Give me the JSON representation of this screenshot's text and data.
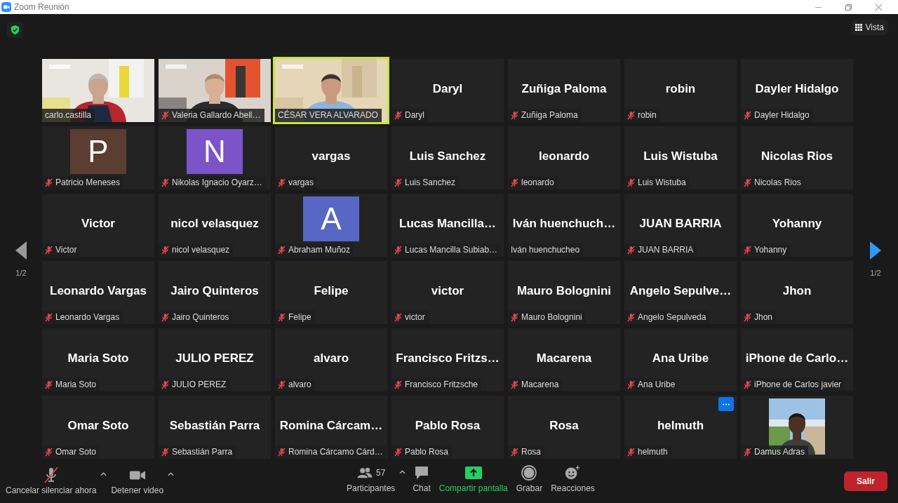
{
  "window": {
    "title": "Zoom Reunión"
  },
  "view_button": {
    "label": "Vista"
  },
  "pager": {
    "left": "1/2",
    "right": "1/2"
  },
  "tiles": [
    {
      "kind": "video",
      "label": "carlo.castilla",
      "muted": false,
      "speaking": false,
      "menu_button": false
    },
    {
      "kind": "video",
      "label": "Valeria Gallardo Abell…",
      "muted": true,
      "speaking": false,
      "menu_button": false
    },
    {
      "kind": "video",
      "label": "CÉSAR VERA ALVARADO",
      "muted": false,
      "speaking": true,
      "menu_button": false
    },
    {
      "kind": "name",
      "display_name": "Daryl",
      "label": "Daryl",
      "muted": true,
      "speaking": false,
      "menu_button": false
    },
    {
      "kind": "name",
      "display_name": "Zuñiga Paloma",
      "label": "Zuñiga Paloma",
      "muted": true,
      "speaking": false,
      "menu_button": false
    },
    {
      "kind": "name",
      "display_name": "robin",
      "label": "robin",
      "muted": true,
      "speaking": false,
      "menu_button": false
    },
    {
      "kind": "name",
      "display_name": "Dayler Hidalgo",
      "label": "Dayler Hidalgo",
      "muted": true,
      "speaking": false,
      "menu_button": false
    },
    {
      "kind": "initial",
      "initial": "P",
      "color": "#5b3d31",
      "label": "Patricio Meneses",
      "muted": true,
      "speaking": false,
      "menu_button": false
    },
    {
      "kind": "initial",
      "initial": "N",
      "color": "#7c53c9",
      "label": "Nikolas Ignacio Oyarz…",
      "muted": true,
      "speaking": false,
      "menu_button": false
    },
    {
      "kind": "name",
      "display_name": "vargas",
      "label": "vargas",
      "muted": true,
      "speaking": false,
      "menu_button": false
    },
    {
      "kind": "name",
      "display_name": "Luis Sanchez",
      "label": "Luis Sanchez",
      "muted": true,
      "speaking": false,
      "menu_button": false
    },
    {
      "kind": "name",
      "display_name": "leonardo",
      "label": "leonardo",
      "muted": true,
      "speaking": false,
      "menu_button": false
    },
    {
      "kind": "name",
      "display_name": "Luis Wistuba",
      "label": "Luis Wistuba",
      "muted": true,
      "speaking": false,
      "menu_button": false
    },
    {
      "kind": "name",
      "display_name": "Nicolas Rios",
      "label": "Nicolas Rios",
      "muted": true,
      "speaking": false,
      "menu_button": false
    },
    {
      "kind": "name",
      "display_name": "Victor",
      "label": "Victor",
      "muted": true,
      "speaking": false,
      "menu_button": false
    },
    {
      "kind": "name",
      "display_name": "nicol velasquez",
      "label": "nicol velasquez",
      "muted": true,
      "speaking": false,
      "menu_button": false
    },
    {
      "kind": "initial",
      "initial": "A",
      "color": "#5867c4",
      "label": "Abraham Muñoz",
      "muted": true,
      "speaking": false,
      "menu_button": false
    },
    {
      "kind": "name",
      "display_name": "Lucas Mancilla…",
      "label": "Lucas Mancilla Subiab…",
      "muted": true,
      "speaking": false,
      "menu_button": false
    },
    {
      "kind": "name",
      "display_name": "Iván huenchuch…",
      "label": "Iván huenchucheo",
      "muted": false,
      "speaking": false,
      "menu_button": false
    },
    {
      "kind": "name",
      "display_name": "JUAN BARRIA",
      "label": "JUAN BARRIA",
      "muted": true,
      "speaking": false,
      "menu_button": false
    },
    {
      "kind": "name",
      "display_name": "Yohanny",
      "label": "Yohanny",
      "muted": true,
      "speaking": false,
      "menu_button": false
    },
    {
      "kind": "name",
      "display_name": "Leonardo Vargas",
      "label": "Leonardo Vargas",
      "muted": true,
      "speaking": false,
      "menu_button": false
    },
    {
      "kind": "name",
      "display_name": "Jairo Quinteros",
      "label": "Jairo Quinteros",
      "muted": true,
      "speaking": false,
      "menu_button": false
    },
    {
      "kind": "name",
      "display_name": "Felipe",
      "label": "Felipe",
      "muted": true,
      "speaking": false,
      "menu_button": false
    },
    {
      "kind": "name",
      "display_name": "victor",
      "label": "victor",
      "muted": true,
      "speaking": false,
      "menu_button": false
    },
    {
      "kind": "name",
      "display_name": "Mauro Bolognini",
      "label": "Mauro Bolognini",
      "muted": true,
      "speaking": false,
      "menu_button": false
    },
    {
      "kind": "name",
      "display_name": "Angelo Sepulve…",
      "label": "Angelo Sepulveda",
      "muted": true,
      "speaking": false,
      "menu_button": false
    },
    {
      "kind": "name",
      "display_name": "Jhon",
      "label": "Jhon",
      "muted": true,
      "speaking": false,
      "menu_button": false
    },
    {
      "kind": "name",
      "display_name": "Maria Soto",
      "label": "Maria Soto",
      "muted": true,
      "speaking": false,
      "menu_button": false
    },
    {
      "kind": "name",
      "display_name": "JULIO PEREZ",
      "label": "JULIO PEREZ",
      "muted": true,
      "speaking": false,
      "menu_button": false
    },
    {
      "kind": "name",
      "display_name": "alvaro",
      "label": "alvaro",
      "muted": true,
      "speaking": false,
      "menu_button": false
    },
    {
      "kind": "name",
      "display_name": "Francisco Fritzs…",
      "label": "Francisco Fritzsche",
      "muted": true,
      "speaking": false,
      "menu_button": false
    },
    {
      "kind": "name",
      "display_name": "Macarena",
      "label": "Macarena",
      "muted": true,
      "speaking": false,
      "menu_button": false
    },
    {
      "kind": "name",
      "display_name": "Ana Uribe",
      "label": "Ana Uribe",
      "muted": true,
      "speaking": false,
      "menu_button": false
    },
    {
      "kind": "name",
      "display_name": "iPhone de Carlo…",
      "label": "iPhone de Carlos javier",
      "muted": true,
      "speaking": false,
      "menu_button": false
    },
    {
      "kind": "name",
      "display_name": "Omar Soto",
      "label": "Omar Soto",
      "muted": true,
      "speaking": false,
      "menu_button": false
    },
    {
      "kind": "name",
      "display_name": "Sebastián Parra",
      "label": "Sebastián Parra",
      "muted": true,
      "speaking": false,
      "menu_button": false
    },
    {
      "kind": "name",
      "display_name": "Romina Cárcam…",
      "label": "Romina Cárcamo Cárd…",
      "muted": true,
      "speaking": false,
      "menu_button": false
    },
    {
      "kind": "name",
      "display_name": "Pablo Rosa",
      "label": "Pablo Rosa",
      "muted": true,
      "speaking": false,
      "menu_button": false
    },
    {
      "kind": "name",
      "display_name": "Rosa",
      "label": "Rosa",
      "muted": true,
      "speaking": false,
      "menu_button": false
    },
    {
      "kind": "name",
      "display_name": "helmuth",
      "label": "helmuth",
      "muted": true,
      "speaking": false,
      "menu_button": true
    },
    {
      "kind": "portrait",
      "label": "Damus Adras",
      "muted": true,
      "speaking": false,
      "menu_button": false
    }
  ],
  "toolbar": [
    {
      "kind": "mic",
      "label": "Cancelar silenciar ahora",
      "muted": true,
      "caret": true
    },
    {
      "kind": "video",
      "label": "Detener video",
      "caret": true
    },
    {
      "kind": "participants",
      "label": "Participantes",
      "count": "57",
      "caret": true
    },
    {
      "kind": "chat",
      "label": "Chat",
      "caret": false
    },
    {
      "kind": "share",
      "label": "Compartir pantalla",
      "caret": false
    },
    {
      "kind": "record",
      "label": "Grabar",
      "caret": false
    },
    {
      "kind": "reactions",
      "label": "Reacciones",
      "caret": false
    }
  ],
  "leave_button": {
    "label": "Salir"
  }
}
